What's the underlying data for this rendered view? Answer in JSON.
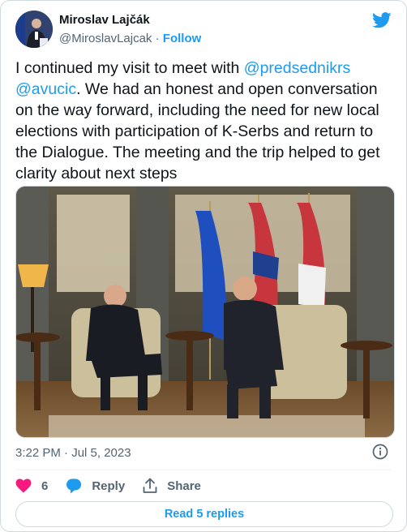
{
  "author": {
    "name": "Miroslav Lajčák",
    "handle": "@MiroslavLajcak",
    "separator": "·",
    "follow_label": "Follow"
  },
  "tweet": {
    "text_before": "I continued my visit to meet with ",
    "mention_1": "@predsednikrs",
    "mention_2": "@avucic",
    "text_after": ". We had an honest and open conversation on the way forward, including the need for new local elections with participation of K-Serbs and return to the Dialogue. The meeting and the trip helped to get clarity about next steps",
    "timestamp": "3:22 PM · Jul 5, 2023"
  },
  "actions": {
    "like_count": "6",
    "reply_label": "Reply",
    "share_label": "Share",
    "read_replies_label": "Read 5 replies"
  },
  "icons": {
    "brand": "twitter-bird-icon",
    "like": "heart-icon",
    "reply": "speech-bubble-icon",
    "share": "share-arrow-icon",
    "info": "info-icon"
  },
  "colors": {
    "accent": "#1d9bf0",
    "like": "#f91880",
    "secondary_text": "#536471",
    "border": "#cfd9de"
  }
}
